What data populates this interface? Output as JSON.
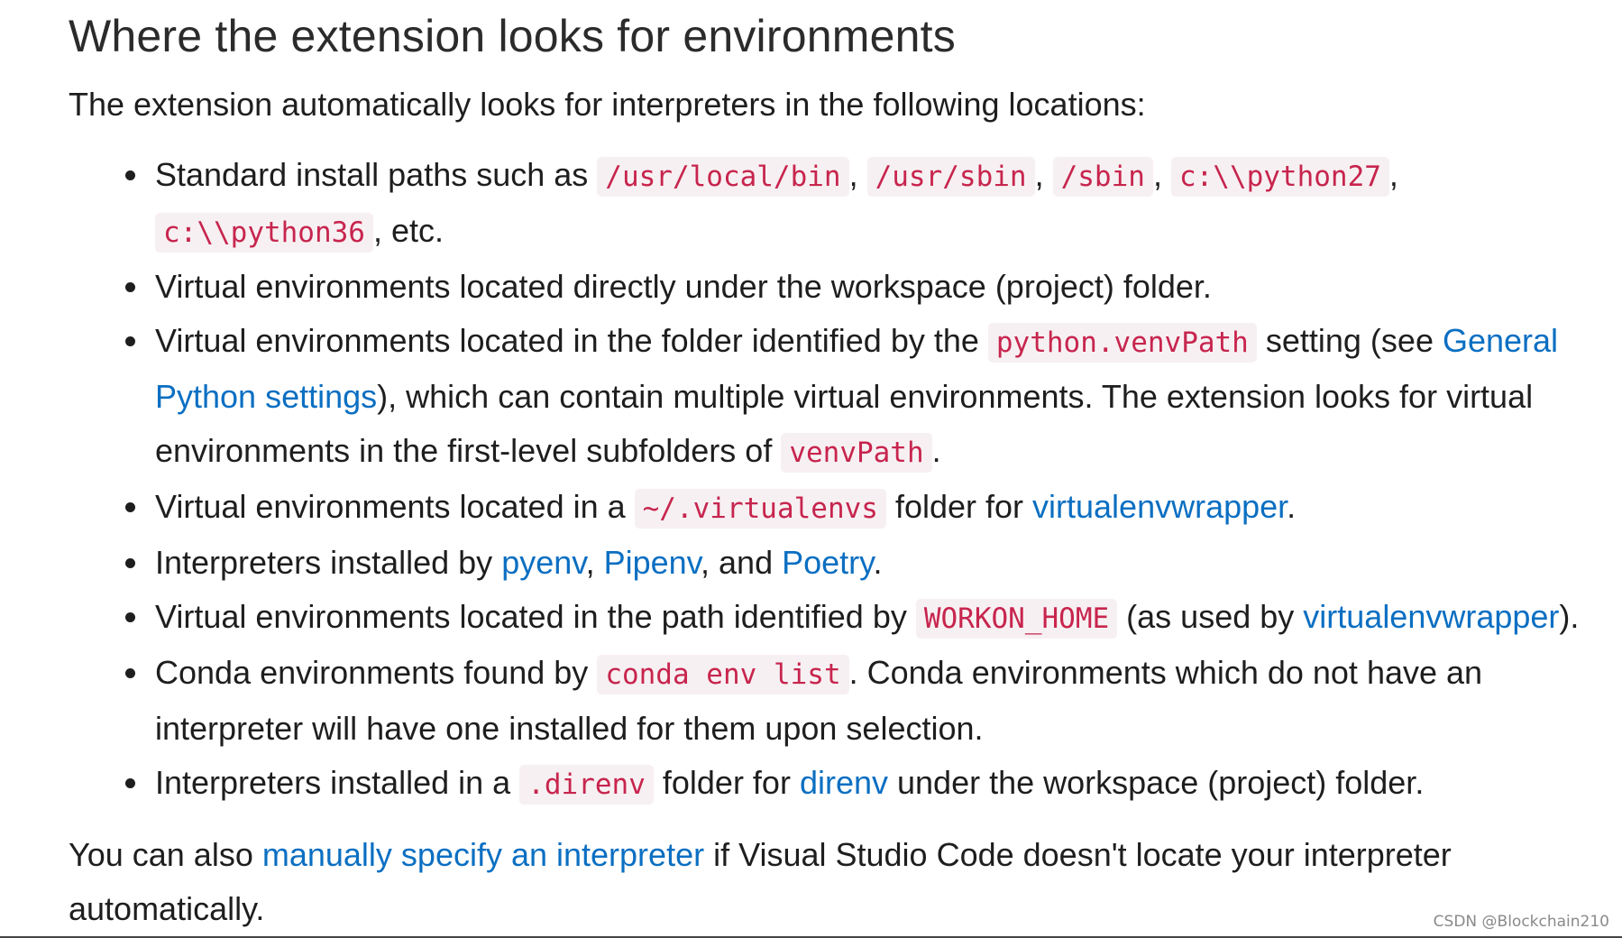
{
  "heading": "Where the extension looks for environments",
  "intro": "The extension automatically looks for interpreters in the following locations:",
  "items": [
    {
      "t1": "Standard install paths such as ",
      "c1": "/usr/local/bin",
      "t2": ", ",
      "c2": "/usr/sbin",
      "t3": ", ",
      "c3": "/sbin",
      "t4": ", ",
      "c4": "c:\\\\python27",
      "t5": ", ",
      "c5": "c:\\\\python36",
      "t6": ", etc."
    },
    {
      "t1": "Virtual environments located directly under the workspace (project) folder."
    },
    {
      "t1": "Virtual environments located in the folder identified by the ",
      "c1": "python.venvPath",
      "t2": " setting (see ",
      "l1": "General Python settings",
      "t3": "), which can contain multiple virtual environments. The extension looks for virtual environments in the first-level subfolders of ",
      "c2": "venvPath",
      "t4": "."
    },
    {
      "t1": "Virtual environments located in a ",
      "c1": "~/.virtualenvs",
      "t2": " folder for ",
      "l1": "virtualenvwrapper",
      "t3": "."
    },
    {
      "t1": "Interpreters installed by ",
      "l1": "pyenv",
      "t2": ", ",
      "l2": "Pipenv",
      "t3": ", and ",
      "l3": "Poetry",
      "t4": "."
    },
    {
      "t1": "Virtual environments located in the path identified by ",
      "c1": "WORKON_HOME",
      "t2": " (as used by ",
      "l1": "virtualenvwrapper",
      "t3": ")."
    },
    {
      "t1": "Conda environments found by ",
      "c1": "conda env list",
      "t2": ". Conda environments which do not have an interpreter will have one installed for them upon selection."
    },
    {
      "t1": "Interpreters installed in a ",
      "c1": ".direnv",
      "t2": " folder for ",
      "l1": "direnv",
      "t3": " under the workspace (project) folder."
    }
  ],
  "outro": {
    "t1": "You can also ",
    "l1": "manually specify an interpreter",
    "t2": " if Visual Studio Code doesn't locate your interpreter automatically."
  },
  "watermark": "CSDN @Blockchain210",
  "colors": {
    "link": "#0b6fc2",
    "code_text": "#c7254e",
    "code_bg": "#f7f0f2",
    "text": "#1e1e1e"
  }
}
